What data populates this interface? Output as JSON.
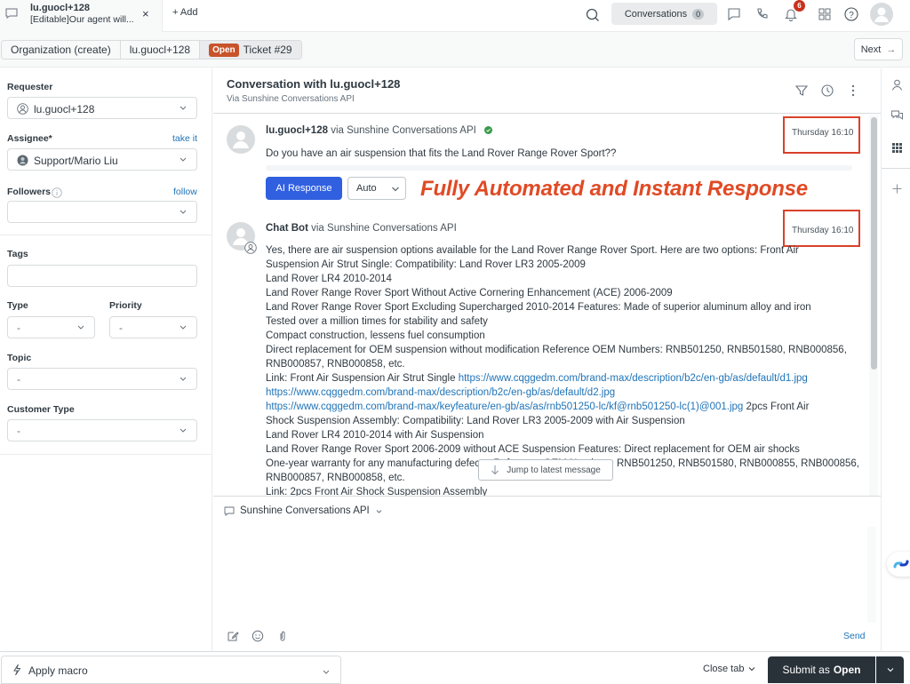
{
  "tab": {
    "title": "lu.guocl+128",
    "subtitle": "[Editable]Our agent will...",
    "close_symbol": "×",
    "add_label": "+ Add"
  },
  "topbar": {
    "conversations_label": "Conversations",
    "conversations_count": "0",
    "notifications_count": "6",
    "icons": [
      "search-icon",
      "chat-icon",
      "phone-icon",
      "bell-icon",
      "apps-icon",
      "help-icon",
      "user-avatar"
    ]
  },
  "breadcrumb": {
    "items": [
      "Organization (create)",
      "lu.guocl+128"
    ],
    "status_badge": "Open",
    "ticket": "Ticket #29",
    "next_label": "Next",
    "next_arrow": "→"
  },
  "sidebar": {
    "requester_label": "Requester",
    "requester_value": "lu.guocl+128",
    "assignee_label": "Assignee*",
    "assignee_action": "take it",
    "assignee_value": "Support/Mario Liu",
    "followers_label": "Followers",
    "followers_action": "follow",
    "followers_value": "",
    "tags_label": "Tags",
    "tags_value": "",
    "type_label": "Type",
    "type_value": "-",
    "priority_label": "Priority",
    "priority_value": "-",
    "topic_label": "Topic",
    "topic_value": "-",
    "customer_type_label": "Customer Type",
    "customer_type_value": "-"
  },
  "conversation": {
    "title": "Conversation with lu.guocl+128",
    "subtitle": "Via Sunshine Conversations API",
    "messages": [
      {
        "sender": "lu.guocl+128",
        "via": "via Sunshine Conversations API",
        "timestamp": "Thursday 16:10",
        "text": "Do you have an air suspension that fits the Land Rover Range Rover Sport??"
      },
      {
        "sender": "Chat Bot",
        "via": "via Sunshine Conversations API",
        "timestamp": "Thursday 16:10",
        "lines": [
          "Yes, there are air suspension options available for the Land Rover Range Rover Sport. Here are two options: Front Air",
          "Suspension Air Strut Single: Compatibility: Land Rover LR3 2005-2009",
          "Land Rover LR4 2010-2014",
          "Land Rover Range Rover Sport Without Active Cornering Enhancement (ACE) 2006-2009",
          "Land Rover Range Rover Sport Excluding Supercharged 2010-2014 Features: Made of superior aluminum alloy and iron",
          "Tested over a million times for stability and safety",
          "Compact construction, lessens fuel consumption",
          "Direct replacement for OEM suspension without modification Reference OEM Numbers: RNB501250, RNB501580, RNB000856,",
          "RNB000857, RNB000858, etc."
        ],
        "link_line_prefix": "Link: Front Air Suspension Air Strut Single ",
        "link1": "https://www.cqggedm.com/brand-max/description/b2c/en-gb/as/default/d1.jpg",
        "link2": "https://www.cqggedm.com/brand-max/description/b2c/en-gb/as/default/d2.jpg",
        "link3": "https://www.cqggedm.com/brand-max/keyfeature/en-gb/as/as/rnb501250-lc/kf@rnb501250-lc(1)@001.jpg",
        "link3_suffix": " 2pcs Front Air",
        "lines_after": [
          "Shock Suspension Assembly: Compatibility: Land Rover LR3 2005-2009 with Air Suspension",
          "Land Rover LR4 2010-2014 with Air Suspension",
          "Land Rover Range Rover Sport 2006-2009 without ACE Suspension Features: Direct replacement for OEM air shocks",
          "One-year warranty for any manufacturing defects. Reference OEM Numbers: RNB501250, RNB501580, RNB000855, RNB000856,",
          "RNB000857, RNB000858, etc.",
          "Link: 2pcs Front Air Shock Suspension Assembly"
        ]
      }
    ],
    "ai_response_label": "AI Response",
    "mode_value": "Auto",
    "annotation": "Fully Automated and Instant Response",
    "jump_label": "Jump to latest message"
  },
  "composer": {
    "channel": "Sunshine Conversations API",
    "text": "",
    "send_label": "Send"
  },
  "footer": {
    "macro_label": "Apply macro",
    "close_tab_label": "Close tab",
    "submit_prefix": "Submit as",
    "submit_status": "Open"
  },
  "colors": {
    "primary": "#3060e0",
    "link": "#1f73b7",
    "open_badge": "#c8532a",
    "annotation": "#e04a25",
    "submit_bg": "#293239",
    "notification_badge": "#c8321d"
  }
}
